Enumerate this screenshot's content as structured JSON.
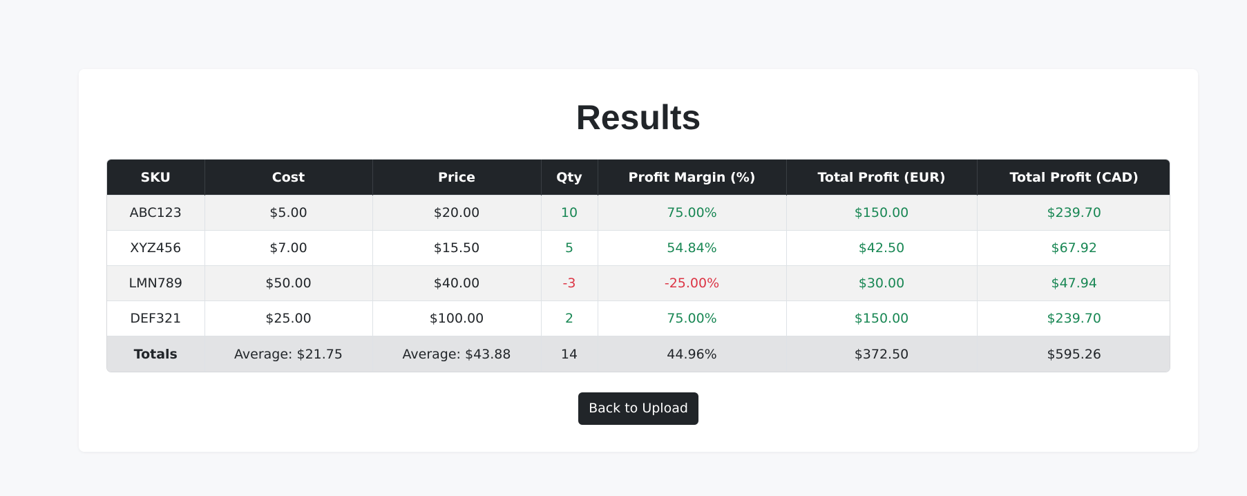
{
  "page": {
    "title": "Results"
  },
  "table": {
    "columns": [
      "SKU",
      "Cost",
      "Price",
      "Qty",
      "Profit Margin (%)",
      "Total Profit (EUR)",
      "Total Profit (CAD)"
    ],
    "rows": [
      {
        "sku": "ABC123",
        "cost": "$5.00",
        "price": "$20.00",
        "qty": "10",
        "margin": "75.00%",
        "profit_eur": "$150.00",
        "profit_cad": "$239.70"
      },
      {
        "sku": "XYZ456",
        "cost": "$7.00",
        "price": "$15.50",
        "qty": "5",
        "margin": "54.84%",
        "profit_eur": "$42.50",
        "profit_cad": "$67.92"
      },
      {
        "sku": "LMN789",
        "cost": "$50.00",
        "price": "$40.00",
        "qty": "-3",
        "margin": "-25.00%",
        "profit_eur": "$30.00",
        "profit_cad": "$47.94"
      },
      {
        "sku": "DEF321",
        "cost": "$25.00",
        "price": "$100.00",
        "qty": "2",
        "margin": "75.00%",
        "profit_eur": "$150.00",
        "profit_cad": "$239.70"
      }
    ],
    "totals": {
      "label": "Totals",
      "cost": "Average: $21.75",
      "price": "Average: $43.88",
      "qty": "14",
      "margin": "44.96%",
      "profit_eur": "$372.50",
      "profit_cad": "$595.26"
    }
  },
  "actions": {
    "back_label": "Back to Upload"
  },
  "colors": {
    "positive": "#198754",
    "negative": "#dc3545",
    "header_bg": "#212529",
    "page_bg": "#f7f8fa"
  }
}
